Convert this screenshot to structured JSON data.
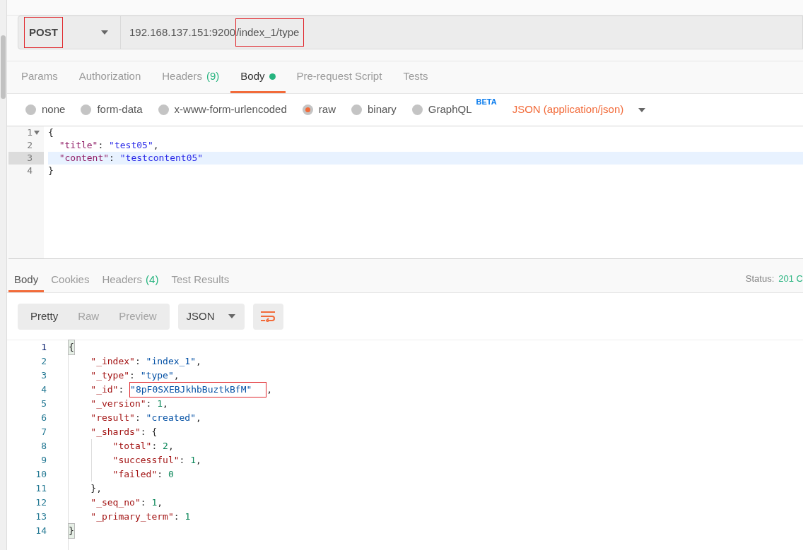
{
  "request": {
    "method": "POST",
    "method_annotated": true,
    "url_parts": [
      {
        "text": "192.168.137.151:9200",
        "annotated": false
      },
      {
        "text": "/index_1/type",
        "annotated": true
      }
    ]
  },
  "request_tabs": [
    {
      "label": "Params",
      "selected": false
    },
    {
      "label": "Authorization",
      "selected": false
    },
    {
      "label": "Headers",
      "count": "(9)",
      "selected": false
    },
    {
      "label": "Body",
      "selected": true,
      "dot": true
    },
    {
      "label": "Pre-request Script",
      "selected": false
    },
    {
      "label": "Tests",
      "selected": false
    }
  ],
  "body_types": [
    {
      "label": "none",
      "selected": false
    },
    {
      "label": "form-data",
      "selected": false
    },
    {
      "label": "x-www-form-urlencoded",
      "selected": false
    },
    {
      "label": "raw",
      "selected": true
    },
    {
      "label": "binary",
      "selected": false
    },
    {
      "label": "GraphQL",
      "badge": "BETA",
      "selected": false
    }
  ],
  "content_type": "JSON (application/json)",
  "request_editor": {
    "lines": [
      {
        "number": "1",
        "foldable": true,
        "active": false,
        "tokens": [
          {
            "kind": "punct",
            "text": "{"
          }
        ]
      },
      {
        "number": "2",
        "foldable": false,
        "active": false,
        "tokens": [
          {
            "kind": "key",
            "text": "  \"title\""
          },
          {
            "kind": "punct",
            "text": ": "
          },
          {
            "kind": "string",
            "text": "\"test05\""
          },
          {
            "kind": "punct",
            "text": ","
          }
        ]
      },
      {
        "number": "3",
        "foldable": false,
        "active": true,
        "tokens": [
          {
            "kind": "key",
            "text": "  \"content\""
          },
          {
            "kind": "punct",
            "text": ": "
          },
          {
            "kind": "string",
            "text": "\"testcontent05\""
          }
        ]
      },
      {
        "number": "4",
        "foldable": false,
        "active": false,
        "tokens": [
          {
            "kind": "punct",
            "text": "}"
          }
        ]
      }
    ]
  },
  "response_tabs": [
    {
      "label": "Body",
      "selected": true
    },
    {
      "label": "Cookies",
      "selected": false
    },
    {
      "label": "Headers",
      "count": "(4)",
      "selected": false
    },
    {
      "label": "Test Results",
      "selected": false
    }
  ],
  "status": {
    "label": "Status:",
    "value": "201 C"
  },
  "view_modes": [
    {
      "label": "Pretty",
      "selected": true
    },
    {
      "label": "Raw",
      "selected": false
    },
    {
      "label": "Preview",
      "selected": false
    }
  ],
  "format": "JSON",
  "response_editor": {
    "lines": [
      {
        "number": "1",
        "matched": true,
        "tokens": [
          {
            "kind": "punct",
            "text": "{"
          }
        ]
      },
      {
        "number": "2",
        "tokens": [
          {
            "kind": "key",
            "text": "    \"_index\""
          },
          {
            "kind": "punct",
            "text": ": "
          },
          {
            "kind": "string",
            "text": "\"index_1\""
          },
          {
            "kind": "punct",
            "text": ","
          }
        ]
      },
      {
        "number": "3",
        "tokens": [
          {
            "kind": "key",
            "text": "    \"_type\""
          },
          {
            "kind": "punct",
            "text": ": "
          },
          {
            "kind": "string",
            "text": "\"type\""
          },
          {
            "kind": "punct",
            "text": ","
          }
        ]
      },
      {
        "number": "4",
        "tokens": [
          {
            "kind": "key",
            "text": "    \"_id\""
          },
          {
            "kind": "punct",
            "text": ": "
          },
          {
            "kind": "string",
            "text": "\"8pF0SXEBJkhbBuztkBfM\"",
            "annotated": true
          },
          {
            "kind": "punct",
            "text": ","
          }
        ]
      },
      {
        "number": "5",
        "tokens": [
          {
            "kind": "key",
            "text": "    \"_version\""
          },
          {
            "kind": "punct",
            "text": ": "
          },
          {
            "kind": "number",
            "text": "1"
          },
          {
            "kind": "punct",
            "text": ","
          }
        ]
      },
      {
        "number": "6",
        "tokens": [
          {
            "kind": "key",
            "text": "    \"result\""
          },
          {
            "kind": "punct",
            "text": ": "
          },
          {
            "kind": "string",
            "text": "\"created\""
          },
          {
            "kind": "punct",
            "text": ","
          }
        ]
      },
      {
        "number": "7",
        "tokens": [
          {
            "kind": "key",
            "text": "    \"_shards\""
          },
          {
            "kind": "punct",
            "text": ": {"
          }
        ]
      },
      {
        "number": "8",
        "guide": true,
        "tokens": [
          {
            "kind": "key",
            "text": "        \"total\""
          },
          {
            "kind": "punct",
            "text": ": "
          },
          {
            "kind": "number",
            "text": "2"
          },
          {
            "kind": "punct",
            "text": ","
          }
        ]
      },
      {
        "number": "9",
        "guide": true,
        "tokens": [
          {
            "kind": "key",
            "text": "        \"successful\""
          },
          {
            "kind": "punct",
            "text": ": "
          },
          {
            "kind": "number",
            "text": "1"
          },
          {
            "kind": "punct",
            "text": ","
          }
        ]
      },
      {
        "number": "10",
        "guide": true,
        "tokens": [
          {
            "kind": "key",
            "text": "        \"failed\""
          },
          {
            "kind": "punct",
            "text": ": "
          },
          {
            "kind": "number",
            "text": "0"
          }
        ]
      },
      {
        "number": "11",
        "tokens": [
          {
            "kind": "punct",
            "text": "    },"
          }
        ]
      },
      {
        "number": "12",
        "tokens": [
          {
            "kind": "key",
            "text": "    \"_seq_no\""
          },
          {
            "kind": "punct",
            "text": ": "
          },
          {
            "kind": "number",
            "text": "1"
          },
          {
            "kind": "punct",
            "text": ","
          }
        ]
      },
      {
        "number": "13",
        "tokens": [
          {
            "kind": "key",
            "text": "    \"_primary_term\""
          },
          {
            "kind": "punct",
            "text": ": "
          },
          {
            "kind": "number",
            "text": "1"
          }
        ]
      },
      {
        "number": "14",
        "matched": true,
        "tokens": [
          {
            "kind": "punct",
            "text": "}"
          }
        ]
      }
    ]
  }
}
